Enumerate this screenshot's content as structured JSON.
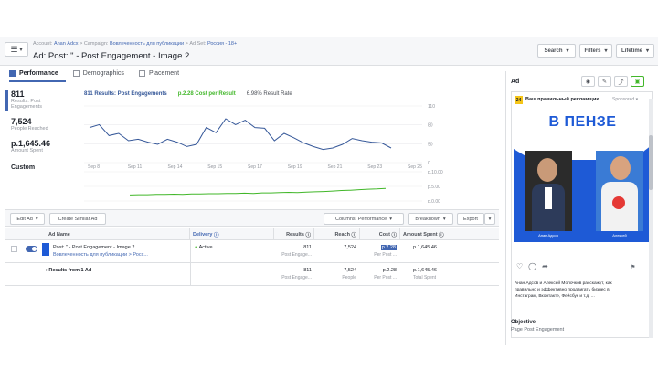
{
  "header": {
    "breadcrumb": {
      "account_label": "Account:",
      "account_name": "Аnаn Аdсх",
      "campaign_label": "Campaign:",
      "campaign_name": "Вовлеченность для публикации",
      "adset_label": "Ad Set:",
      "adset_name": "Россия - 18+"
    },
    "title": "Ad: Post: \" - Post Engagement - Image 2",
    "buttons": {
      "search": "Search",
      "filters": "Filters",
      "lifetime": "Lifetime"
    }
  },
  "tabs": [
    {
      "label": "Performance",
      "active": true
    },
    {
      "label": "Demographics",
      "active": false
    },
    {
      "label": "Placement",
      "active": false
    }
  ],
  "metrics": {
    "results_value": "811",
    "results_label1": "Results: Post",
    "results_label2": "Engagements",
    "reach_value": "7,524",
    "reach_label": "People Reached",
    "spent_value": "р.1,645.46",
    "spent_label": "Amount Spent",
    "custom_label": "Custom"
  },
  "legend": {
    "results": "811 Results: Post Engagements",
    "cost": "р.2.28 Cost per Result",
    "rate": "6.98% Result Rate"
  },
  "chart_data": {
    "type": "line",
    "x": [
      "Sep 8",
      "Sep 11",
      "Sep 14",
      "Sep 15",
      "Sep 17",
      "Sep 19",
      "Sep 21",
      "Sep 23",
      "Sep 25"
    ],
    "top_yticks": [
      "110",
      "80",
      "50",
      "0"
    ],
    "bottom_yticks": [
      "р.10.00",
      "р.5.00",
      "р.0.00"
    ],
    "series": [
      {
        "name": "Results: Post Engagements",
        "color": "#365899",
        "values": [
          78,
          82,
          67,
          70,
          60,
          62,
          58,
          55,
          62,
          58,
          52,
          55,
          78,
          71,
          90,
          82,
          88,
          78,
          77,
          60,
          70,
          64,
          57,
          52,
          48,
          50,
          55,
          63,
          60,
          58,
          57,
          50
        ]
      },
      {
        "name": "Cost per Result",
        "color": "#42b72a",
        "values": [
          1.6,
          1.7,
          1.7,
          1.8,
          1.8,
          1.9,
          1.8,
          2.0,
          2.0,
          2.1,
          2.1,
          2.2,
          2.2,
          2.3,
          2.2,
          2.4,
          2.4,
          2.5,
          2.6,
          2.5,
          2.7,
          2.8,
          2.9,
          3.1,
          3.3,
          3.4,
          3.6,
          3.8,
          3.9,
          4.1
        ]
      }
    ]
  },
  "toolbar": {
    "edit_ad": "Edit Ad",
    "create_similar": "Create Similar Ad",
    "columns": "Columns: Performance",
    "breakdown": "Breakdown",
    "export": "Export"
  },
  "table": {
    "headers": [
      "Ad Name",
      "Delivery",
      "Results",
      "Reach",
      "Cost",
      "Amount Spent"
    ],
    "row": {
      "name": "Post: \" - Post Engagement - Image 2",
      "sub": "Вовлеченность для публикации > Росс...",
      "delivery": "Active",
      "results": "811",
      "results_sub": "Post Engage...",
      "reach": "7,524",
      "cost": "р.2.28",
      "cost_sub": "Per Post ...",
      "spent": "р.1,645.46"
    },
    "total": {
      "label": "Results from 1 Ad",
      "results": "811",
      "results_sub": "Post Engage...",
      "reach": "7,524",
      "reach_sub": "People",
      "cost": "р.2.28",
      "cost_sub": "Per Post ...",
      "spent": "р.1,645.46",
      "spent_sub": "Total Spent"
    }
  },
  "preview": {
    "title": "Ad",
    "page_name": "Ваш правильный рекламщик",
    "sponsored": "Sponsored",
    "creative_title": "В ПЕНЗЕ",
    "caption_l": "Aнан Адсов",
    "caption_r": "Алексей",
    "post_text1": "Aнан Адсов и Алексей Молочков расскажут, как",
    "post_text2": "правильно и эффективно продвигать бизнес в",
    "post_text3": "Инстаграм, Вконтакте, Фейсбук и т.д. ...",
    "objective_label": "Objective",
    "objective_value": "Page Post Engagement"
  }
}
